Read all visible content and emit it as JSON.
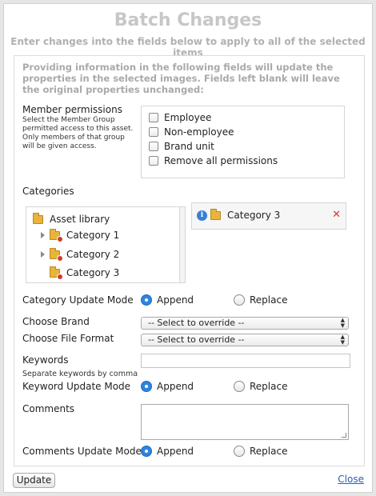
{
  "dialog": {
    "title": "Batch Changes",
    "subtitle": "Enter changes into the fields below to apply to all of the selected items",
    "intro": "Providing information in the following fields will update the properties in the selected images. Fields left blank will leave the original properties unchanged:"
  },
  "permissions": {
    "label": "Member permissions",
    "hint": "Select the Member Group permitted access to this asset. Only members of that group will be given access.",
    "options": [
      "Employee",
      "Non-employee",
      "Brand unit",
      "Remove all permissions"
    ]
  },
  "categories": {
    "label": "Categories",
    "tree": [
      {
        "label": "Asset library",
        "icon": "folder-icon"
      },
      {
        "label": "Category 1",
        "icon": "folder-remove-icon",
        "expandable": true
      },
      {
        "label": "Category 2",
        "icon": "folder-remove-icon",
        "expandable": true
      },
      {
        "label": "Category 3",
        "icon": "folder-remove-icon",
        "expandable": false
      }
    ],
    "selected": [
      {
        "label": "Category 3"
      }
    ]
  },
  "category_update_mode": {
    "label": "Category Update Mode",
    "append": "Append",
    "replace": "Replace",
    "selected": "Append"
  },
  "brand": {
    "label": "Choose Brand",
    "value": "-- Select to override --"
  },
  "file_format": {
    "label": "Choose File Format",
    "value": "-- Select to override --"
  },
  "keywords": {
    "label": "Keywords",
    "hint": "Separate keywords by comma",
    "value": ""
  },
  "keyword_update_mode": {
    "label": "Keyword Update Mode",
    "append": "Append",
    "replace": "Replace",
    "selected": "Append"
  },
  "comments": {
    "label": "Comments",
    "value": ""
  },
  "comments_update_mode": {
    "label": "Comments Update Mode",
    "append": "Append",
    "replace": "Replace",
    "selected": "Append"
  },
  "footer": {
    "update_label": "Update",
    "close_label": "Close"
  },
  "colors": {
    "accent": "#2f84e0",
    "title": "#c7c7c7",
    "link": "#2a5db0",
    "remove": "#d23b2b"
  }
}
